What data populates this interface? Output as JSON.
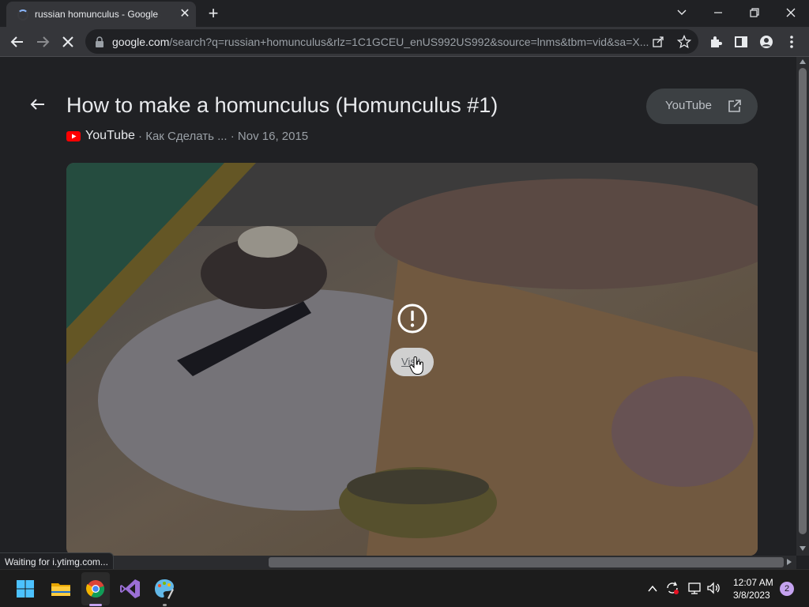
{
  "browser": {
    "tab_title": "russian homunculus - Google Se",
    "url_host": "google.com",
    "url_path": "/search?q=russian+homunculus&rlz=1C1GCEU_enUS992US992&source=lnms&tbm=vid&sa=X...",
    "status_text": "Waiting for i.ytimg.com..."
  },
  "video": {
    "title": "How to make a homunculus (Homunculus #1)",
    "source": "YouTube",
    "channel": "Как Сделать ...",
    "date": "Nov 16, 2015",
    "separator": "·",
    "open_button_label": "YouTube",
    "visit_label": "Visit"
  },
  "taskbar": {
    "time": "12:07 AM",
    "date": "3/8/2023",
    "notification_count": "2"
  },
  "colors": {
    "background": "#202124",
    "youtube_red": "#ff0000",
    "accent_blue": "#8ab4f8"
  }
}
